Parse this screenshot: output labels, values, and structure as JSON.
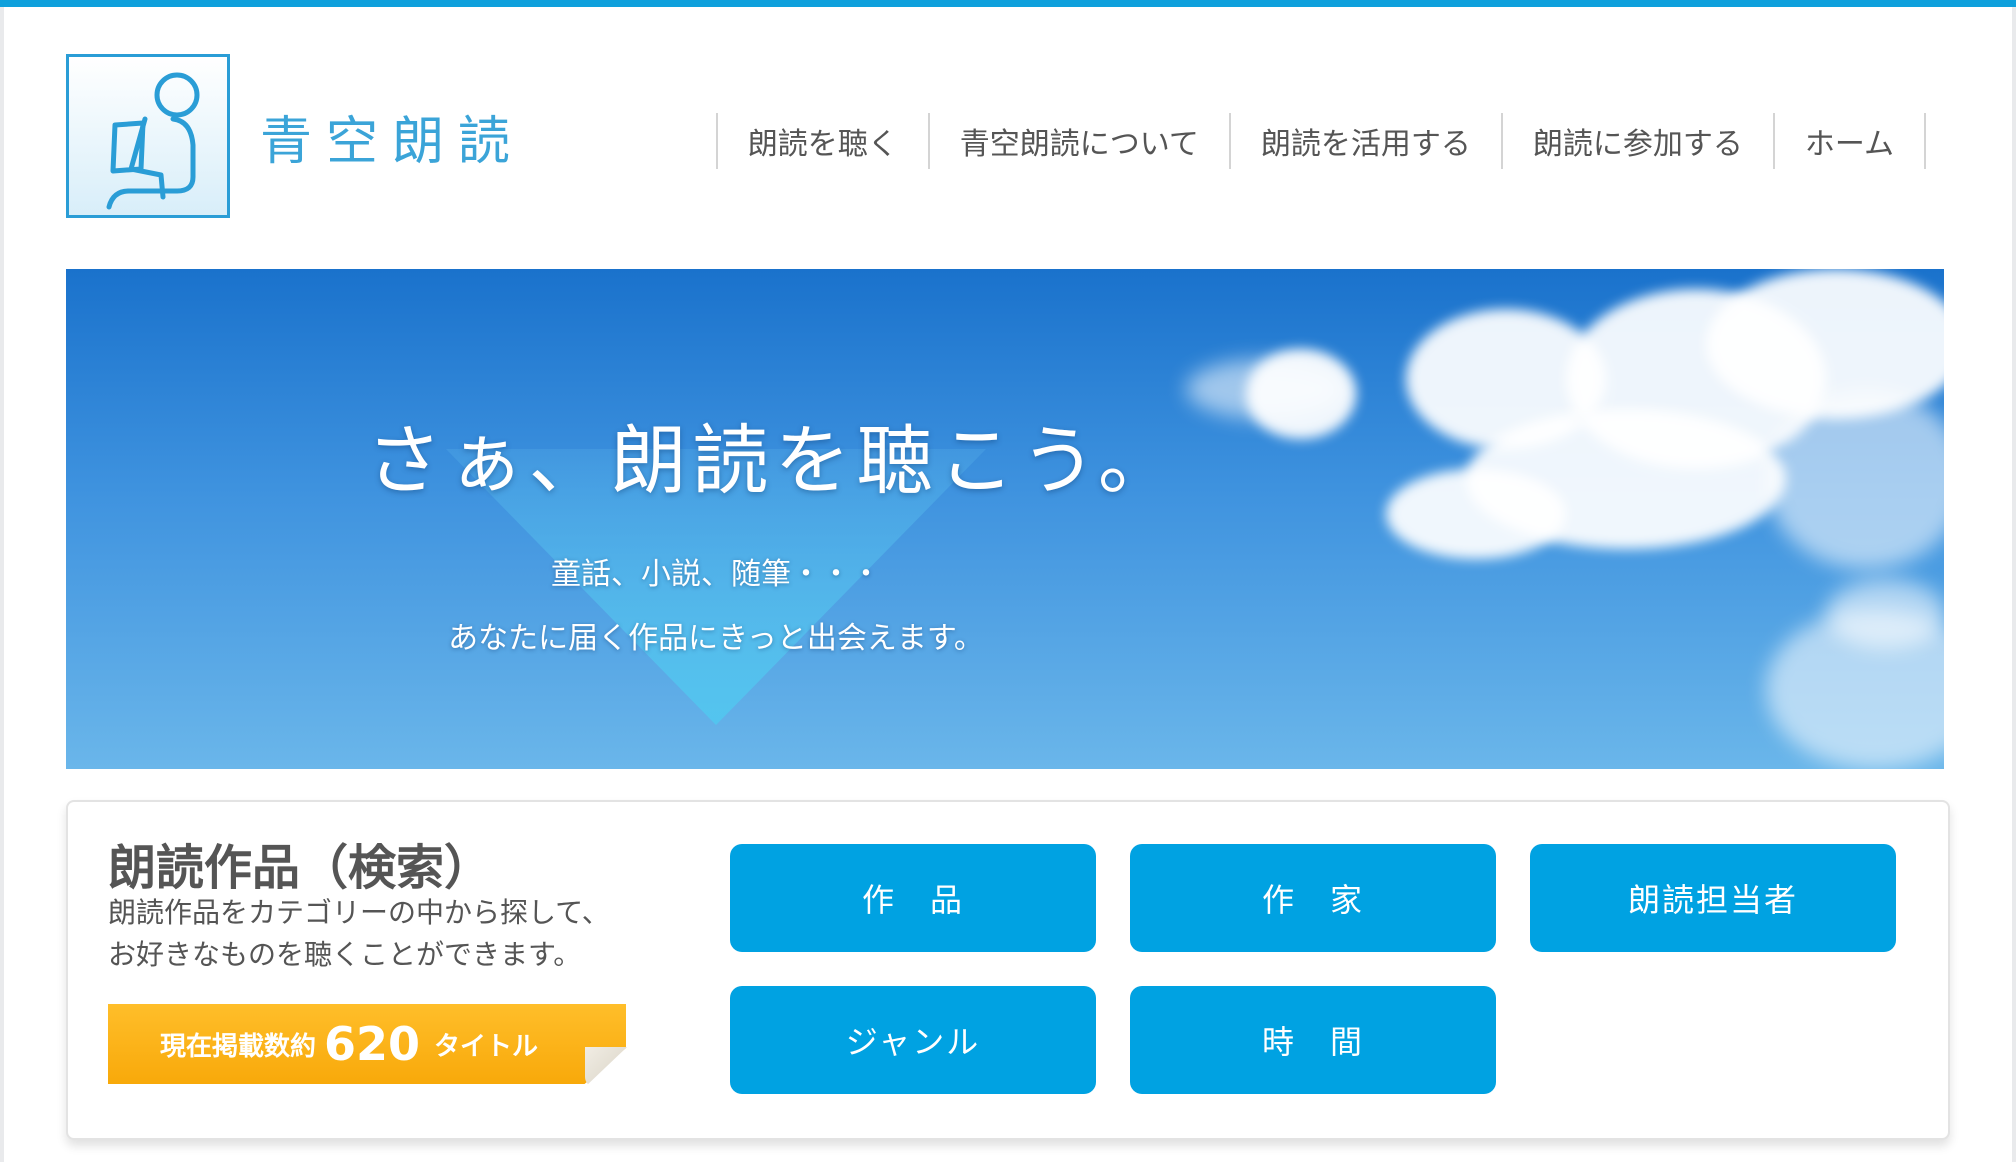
{
  "header": {
    "logo_text": "青空朗読",
    "nav": [
      {
        "label": "朗読を聴く"
      },
      {
        "label": "青空朗読について"
      },
      {
        "label": "朗読を活用する"
      },
      {
        "label": "朗読に参加する"
      },
      {
        "label": "ホーム"
      }
    ]
  },
  "hero": {
    "title": "さぁ、朗読を聴こう。",
    "line1": "童話、小説、随筆・・・",
    "line2": "あなたに届く作品にきっと出会えます。"
  },
  "search": {
    "title": "朗読作品（検索）",
    "desc_line1": "朗読作品をカテゴリーの中から探して、",
    "desc_line2": "お好きなものを聴くことができます。",
    "count_prefix": "現在掲載数約",
    "count_number": "620",
    "count_suffix": "タイトル",
    "categories": [
      {
        "label": "作　品"
      },
      {
        "label": "作　家"
      },
      {
        "label": "朗読担当者"
      },
      {
        "label": "ジャンル"
      },
      {
        "label": "時　間"
      }
    ]
  },
  "colors": {
    "accent": "#0ea0dc",
    "button": "#00a2e2",
    "banner": "#f8a90a"
  }
}
